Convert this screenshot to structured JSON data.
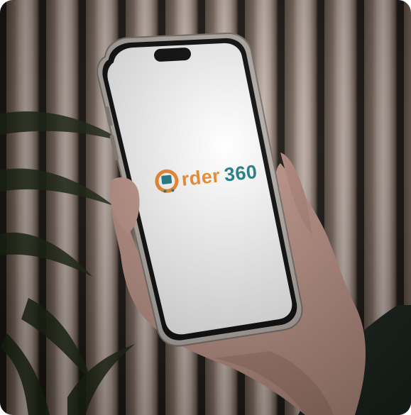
{
  "logo": {
    "word": "rder",
    "number": "360",
    "word_color": "#ef8a2c",
    "number_color": "#1f7b86",
    "icon": "cart-o-icon"
  }
}
